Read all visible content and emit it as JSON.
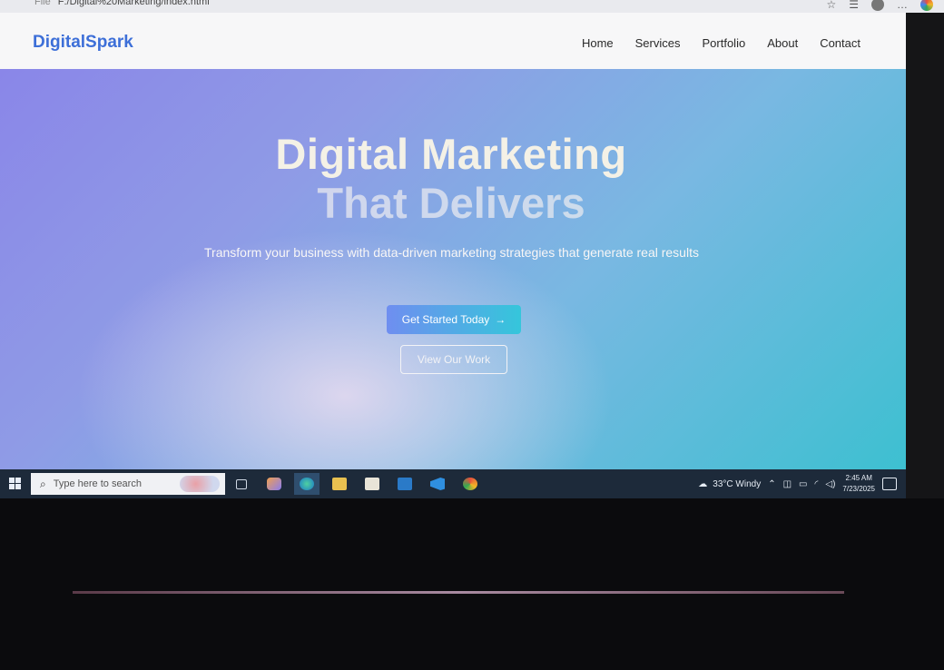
{
  "browser": {
    "scheme": "File",
    "url": "F:/Digital%20Marketing/index.html"
  },
  "site": {
    "logo": "DigitalSpark",
    "nav": [
      "Home",
      "Services",
      "Portfolio",
      "About",
      "Contact"
    ]
  },
  "hero": {
    "title_line1": "Digital Marketing",
    "title_line2": "That Delivers",
    "subtitle": "Transform your business with data-driven marketing strategies that generate real results",
    "primary_button": "Get Started Today",
    "primary_button_icon": "arrow-right-icon",
    "secondary_button": "View Our Work"
  },
  "taskbar": {
    "search_placeholder": "Type here to search",
    "weather": "33°C  Windy",
    "time": "2:45 AM",
    "date": "7/23/2025"
  },
  "colors": {
    "logo": "#3d6fd8",
    "hero_gradient_start": "#8a86e8",
    "hero_gradient_end": "#3bc0d0",
    "taskbar": "#1d2a3a"
  }
}
